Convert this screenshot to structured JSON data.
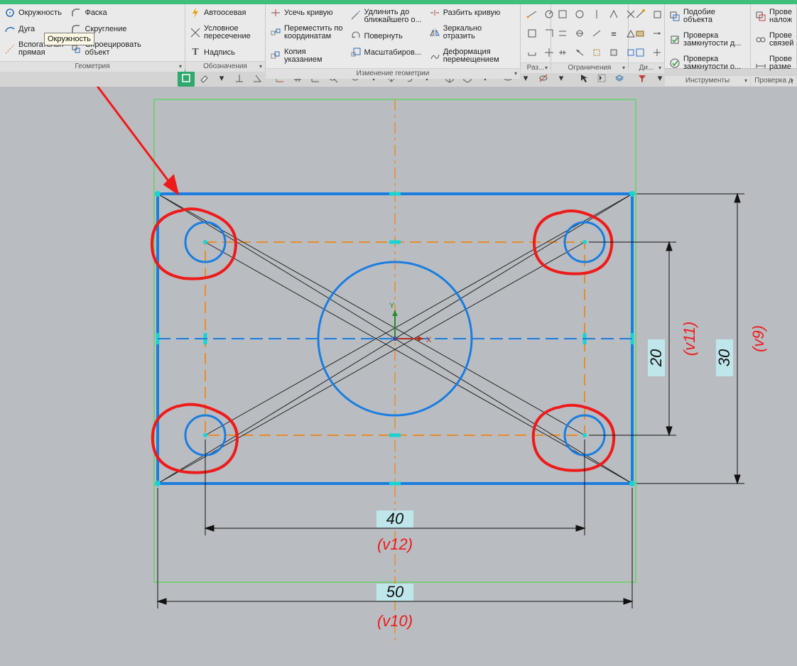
{
  "ribbon": {
    "geometry": {
      "title": "Геометрия",
      "circle": "Окружность",
      "arc": "Дуга",
      "auxline": "Вспогательн\nпрямая",
      "chamfer": "Фаска",
      "fillet": "Скругление",
      "project": "Спроецировать\nобъект",
      "tooltip": "Окружность"
    },
    "annot": {
      "title": "Обозначения",
      "autoaxis": "Автоосевая",
      "cond": "Условное\nпересечение",
      "text": "Надпись"
    },
    "modify": {
      "title": "Изменение геометрии",
      "trim": "Усечь кривую",
      "move": "Переместить по\nкоординатам",
      "copy": "Копия\nуказанием",
      "extend": "Удлинить до\nближайшего о...",
      "rotate": "Повернуть",
      "scale": "Масштабиров...",
      "split": "Разбить кривую",
      "mirror": "Зеркально\nотразить",
      "deform": "Деформация\nперемещением"
    },
    "sizes": {
      "title": "Раз..."
    },
    "constraints": {
      "title": "Ограничения"
    },
    "diag": {
      "title": "Ди..."
    },
    "tools": {
      "title": "Инструменты",
      "similar": "Подобие\nобъекта",
      "check1": "Проверка\nзамкнутости д...",
      "check2": "Проверка\nзамкнутости о..."
    },
    "check": {
      "title": "Проверка д",
      "a": "Прове\nналож",
      "b": "Прове\nсвязей",
      "c": "Прове\nразме"
    }
  },
  "sketch": {
    "dim50": {
      "val": "50",
      "var": "(v10)"
    },
    "dim40": {
      "val": "40",
      "var": "(v12)"
    },
    "dim30": {
      "val": "30",
      "var": "(v9)"
    },
    "dim20": {
      "val": "20",
      "var": "(v11)"
    },
    "axis": {
      "x": "X",
      "y": "Y"
    }
  }
}
